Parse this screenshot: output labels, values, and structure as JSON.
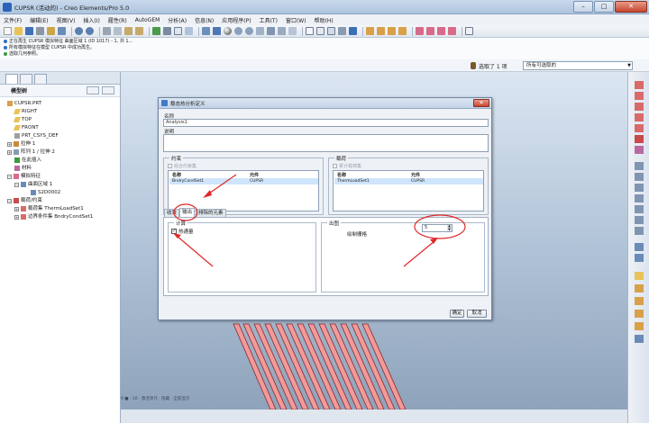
{
  "window": {
    "title": "CUPSR (活动的) - Creo Elements/Pro 5.0",
    "minimize": "–",
    "maximize": "□",
    "close": "✕"
  },
  "menu": [
    "文件(F)",
    "编辑(E)",
    "视图(V)",
    "插入(I)",
    "履性(R)",
    "AutoGEM",
    "分析(A)",
    "信息(N)",
    "应用程序(P)",
    "工具(T)",
    "窗口(W)",
    "帮助(H)"
  ],
  "messages": [
    "正在再生 CUPSR 模拟特征 曲面区域 1 (ID 1017) - 1, 共 1...",
    "所有模拟特征在模型 CUPSR 中成功再生。",
    "选取几何参照。"
  ],
  "selection": {
    "text": "选取了 1 项",
    "filter": "所有可选取的"
  },
  "model_tree": {
    "title": "模型树",
    "items": [
      "CUPSR.PRT",
      "RIGHT",
      "TOP",
      "FRONT",
      "PRT_CSYS_DEF",
      "拉伸 1",
      "阵列 1 / 拉伸 2",
      "在此插入",
      "材料",
      "模拟特征",
      "曲面区域 1",
      "S2D0002",
      "载荷/约束",
      "载荷集 ThermLoadSet1",
      "边界条件集 BndryCondSet1"
    ]
  },
  "viewport_status": "9 ■ · 10 · 激活单元 · 隐藏 · 全部显示",
  "dialog": {
    "title": "稳态热分析定义",
    "name_label": "名称",
    "name_value": "Analysis1",
    "desc_label": "说明",
    "constraints": {
      "title": "约束",
      "combine_label": "组合约束集",
      "col_name": "名称",
      "col_component": "元件",
      "rows": [
        {
          "name": "BndryCondSet1",
          "component": "CUPSR"
        }
      ]
    },
    "loads": {
      "title": "载荷",
      "sum_label": "累计载荷集",
      "col_name": "名称",
      "col_component": "元件",
      "rows": [
        {
          "name": "ThermLoadSet1",
          "component": "CUPSR"
        }
      ]
    },
    "tabs": [
      "收敛",
      "输出",
      "排除的元素"
    ],
    "active_tab": "输出",
    "calc_group": "计算",
    "heat_flux_label": "热通量",
    "heat_flux_checked": "✓",
    "plot_group": "出图",
    "plot_grid_label": "绘制栅格",
    "plot_grid_value": "5",
    "ok": "确定",
    "cancel": "取消"
  },
  "colors": {
    "accent": "#2e62b8",
    "annotation": "#e0282a",
    "viewport_top": "#dbe6f2",
    "viewport_bottom": "#8ea3bb"
  }
}
